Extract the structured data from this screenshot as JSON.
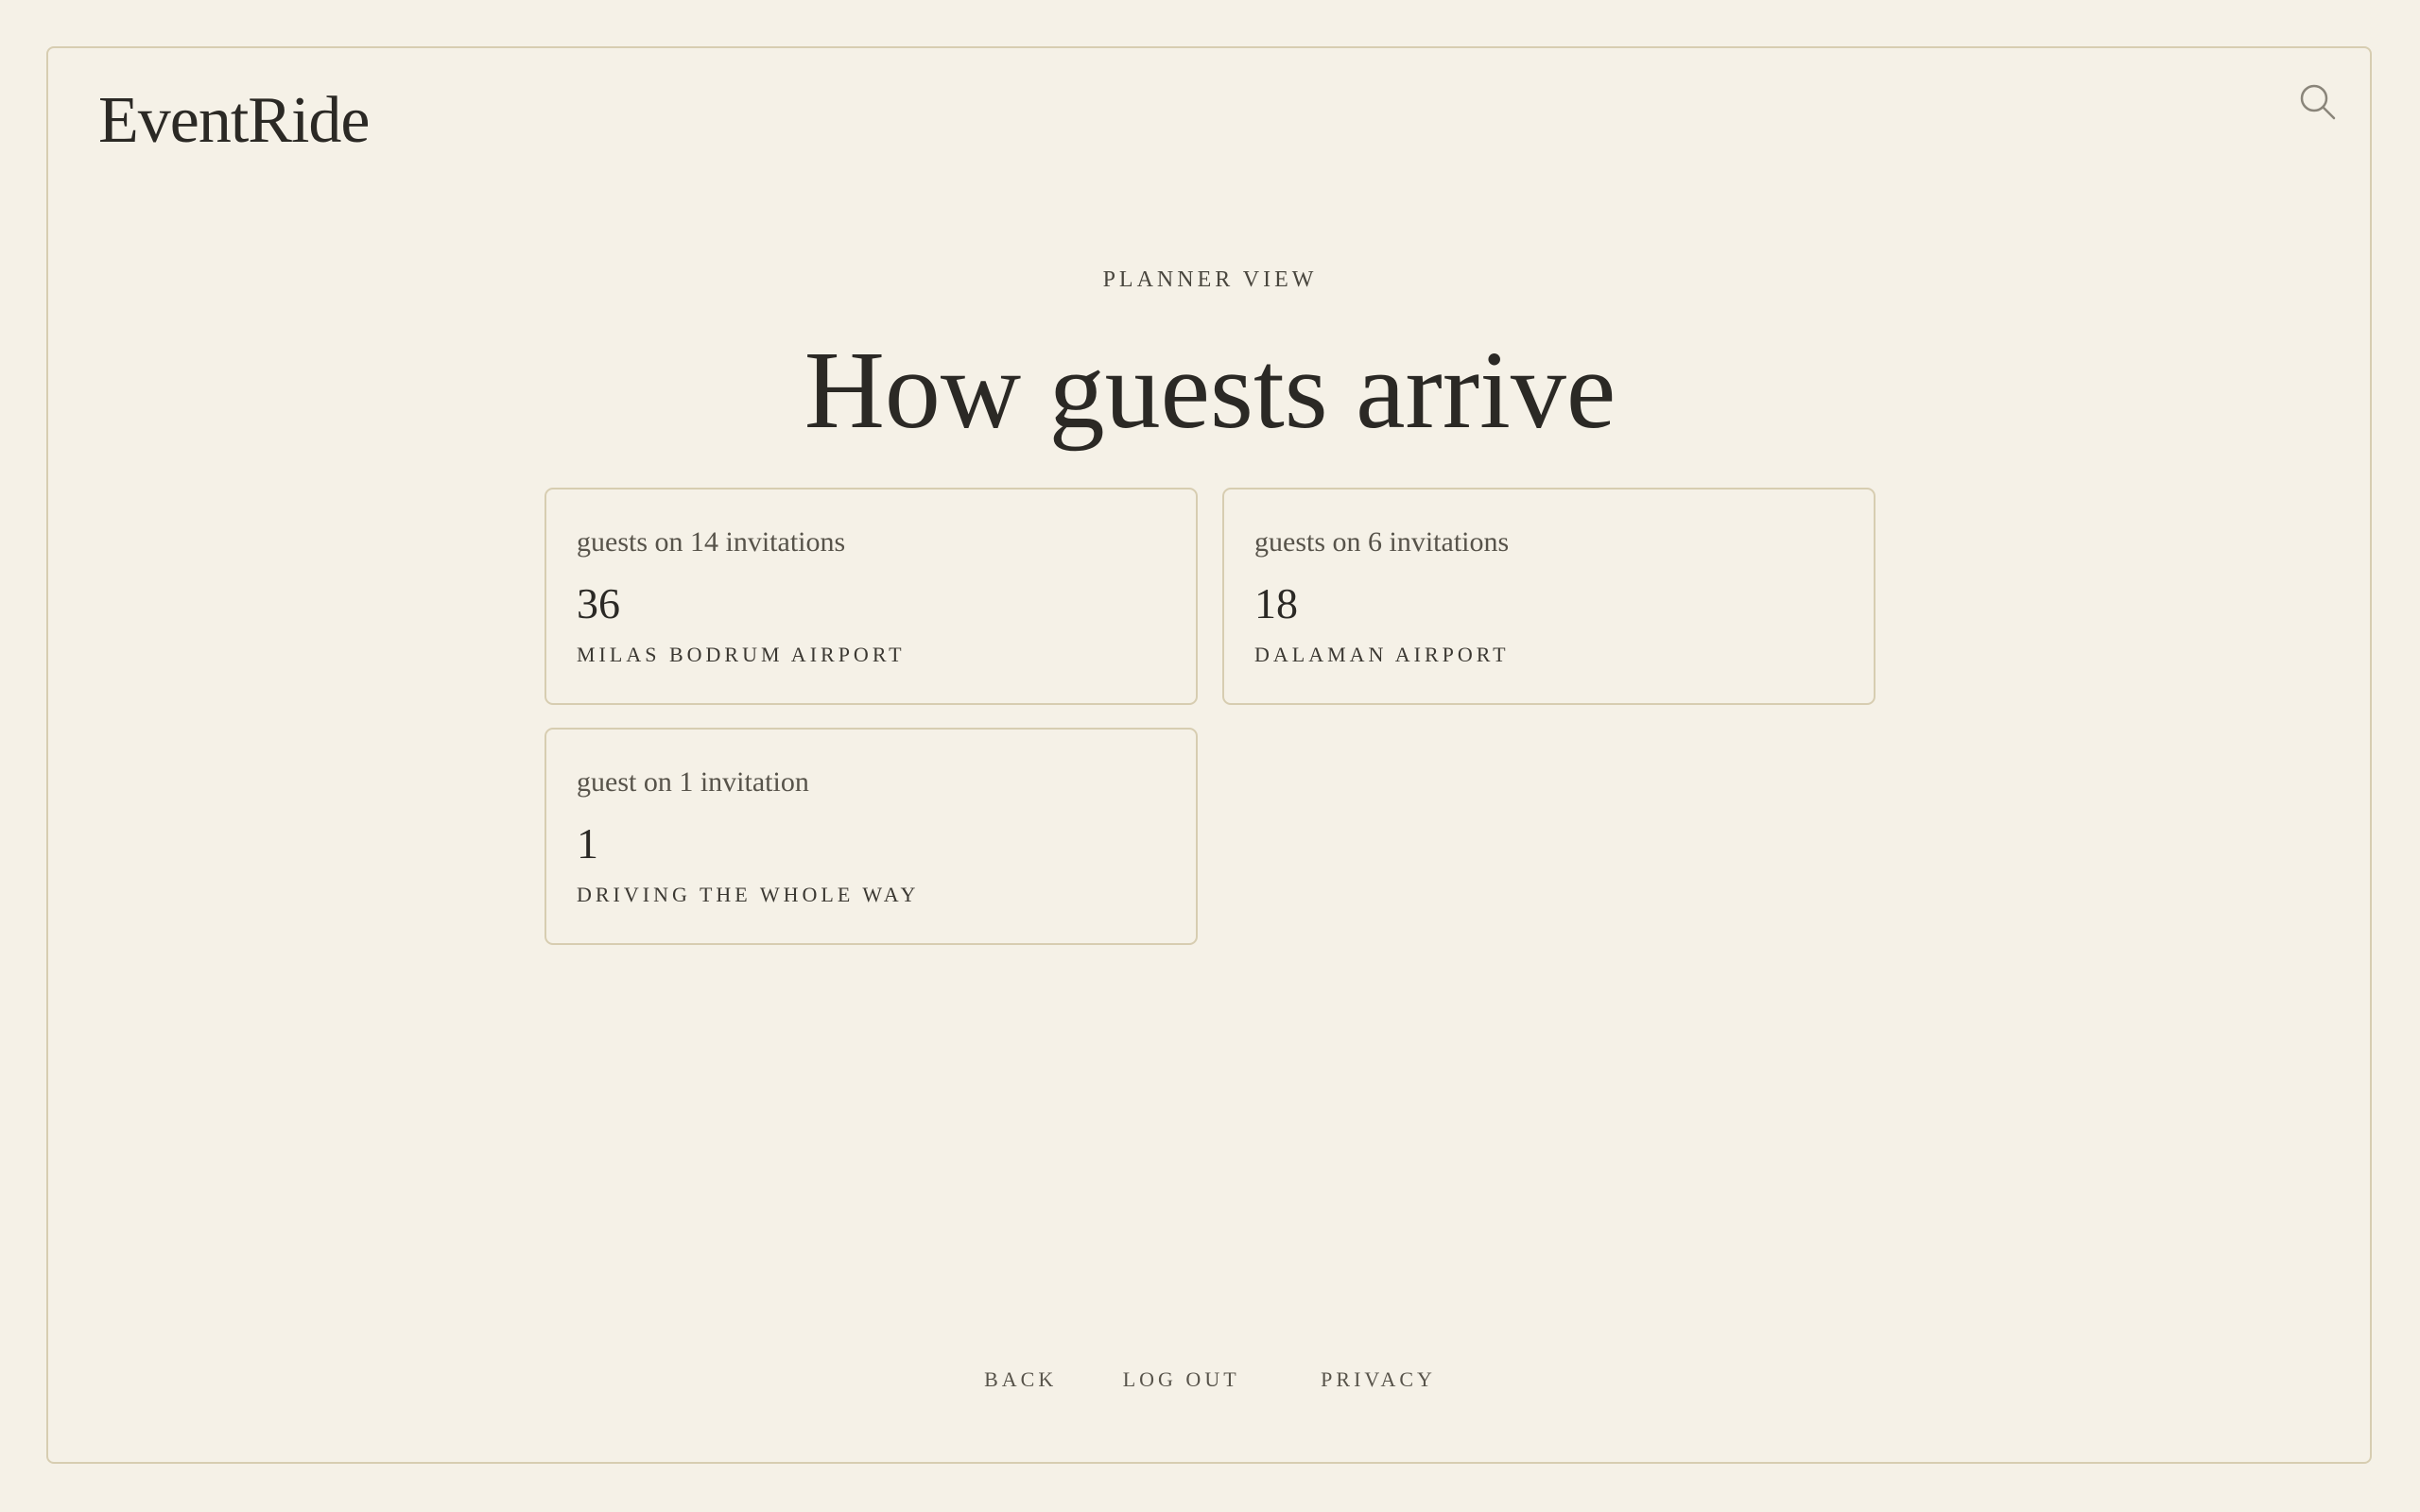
{
  "brand": {
    "name": "EventRide"
  },
  "header": {
    "search_icon": "search-icon"
  },
  "hero": {
    "eyebrow": "PLANNER VIEW",
    "title": "How guests arrive"
  },
  "cards": [
    {
      "caption": "guests on 14 invitations",
      "value": "36",
      "place": "MILAS BODRUM AIRPORT"
    },
    {
      "caption": "guests on 6 invitations",
      "value": "18",
      "place": "DALAMAN AIRPORT"
    },
    {
      "caption": "guest on 1 invitation",
      "value": "1",
      "place": "DRIVING THE WHOLE WAY"
    }
  ],
  "footer": {
    "back": "BACK",
    "logout": "LOG OUT",
    "privacy": "PRIVACY"
  },
  "colors": {
    "background": "#f5f1e7",
    "border": "#d7cdb1",
    "text": "#2b2925"
  }
}
